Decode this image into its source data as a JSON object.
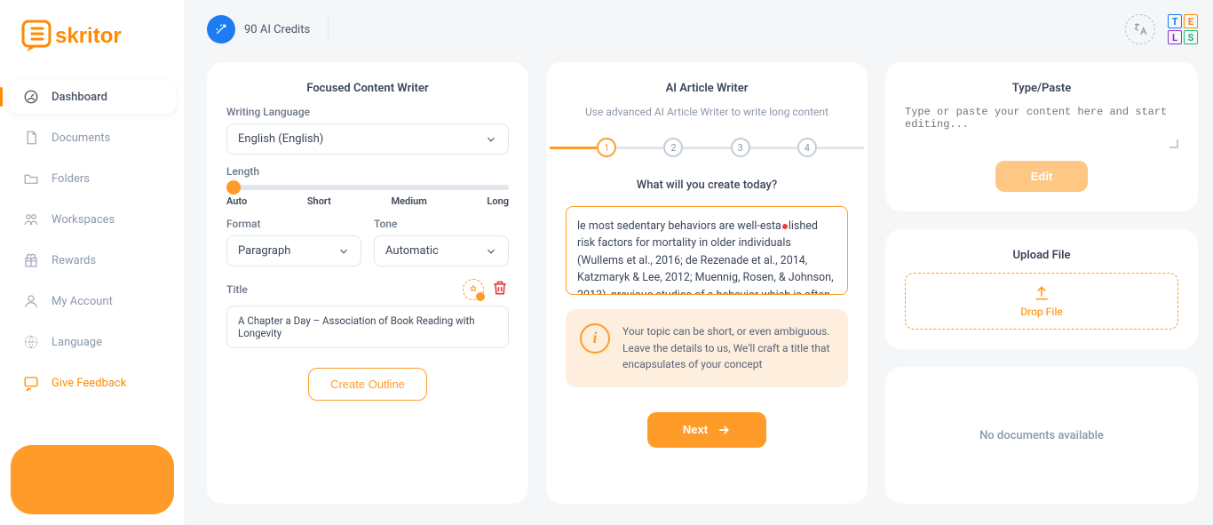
{
  "brand": "Eskritor",
  "topbar": {
    "credits": "90 AI Credits"
  },
  "sidebar": {
    "items": [
      {
        "label": "Dashboard"
      },
      {
        "label": "Documents"
      },
      {
        "label": "Folders"
      },
      {
        "label": "Workspaces"
      },
      {
        "label": "Rewards"
      },
      {
        "label": "My Account"
      },
      {
        "label": "Language"
      },
      {
        "label": "Give Feedback"
      }
    ]
  },
  "focused": {
    "title": "Focused Content Writer",
    "lang_label": "Writing Language",
    "lang_value": "English (English)",
    "length_label": "Length",
    "length_marks": {
      "auto": "Auto",
      "short": "Short",
      "medium": "Medium",
      "long": "Long"
    },
    "format_label": "Format",
    "format_value": "Paragraph",
    "tone_label": "Tone",
    "tone_value": "Automatic",
    "title_label": "Title",
    "title_value": "A Chapter a Day – Association of Book Reading with Longevity",
    "outline_btn": "Create Outline"
  },
  "article": {
    "title": "AI Article Writer",
    "subtitle": "Use advanced AI Article Writer to write long content",
    "steps": [
      "1",
      "2",
      "3",
      "4"
    ],
    "question": "What will you create today?",
    "input_pre": "le most sedentary behaviors are well-esta",
    "input_post": "lished risk factors for mortality in older individuals (Wullems et al., 2016; de Rezenade et al., 2014, Katzmaryk & Lee, 2012; Muennig, Rosen, & Johnson, 2013), previous studies of a behavior which is often sedentary, reading, have had mixed outcomes. That is,",
    "tip": "Your topic can be short, or even ambiguous. Leave the details to us, We'll craft a title that encapsulates of your concept",
    "next": "Next"
  },
  "typepaste": {
    "title": "Type/Paste",
    "placeholder": "Type or paste your content here and start editing...",
    "edit": "Edit"
  },
  "upload": {
    "title": "Upload File",
    "drop": "Drop File"
  },
  "docs": {
    "empty": "No documents available"
  },
  "grid_letters": {
    "a": "T",
    "b": "E",
    "c": "L",
    "d": "S"
  },
  "grid_colors": {
    "a": "#1d7cf2",
    "b": "#ff8a00",
    "c": "#8e2de2",
    "d": "#17b978"
  }
}
